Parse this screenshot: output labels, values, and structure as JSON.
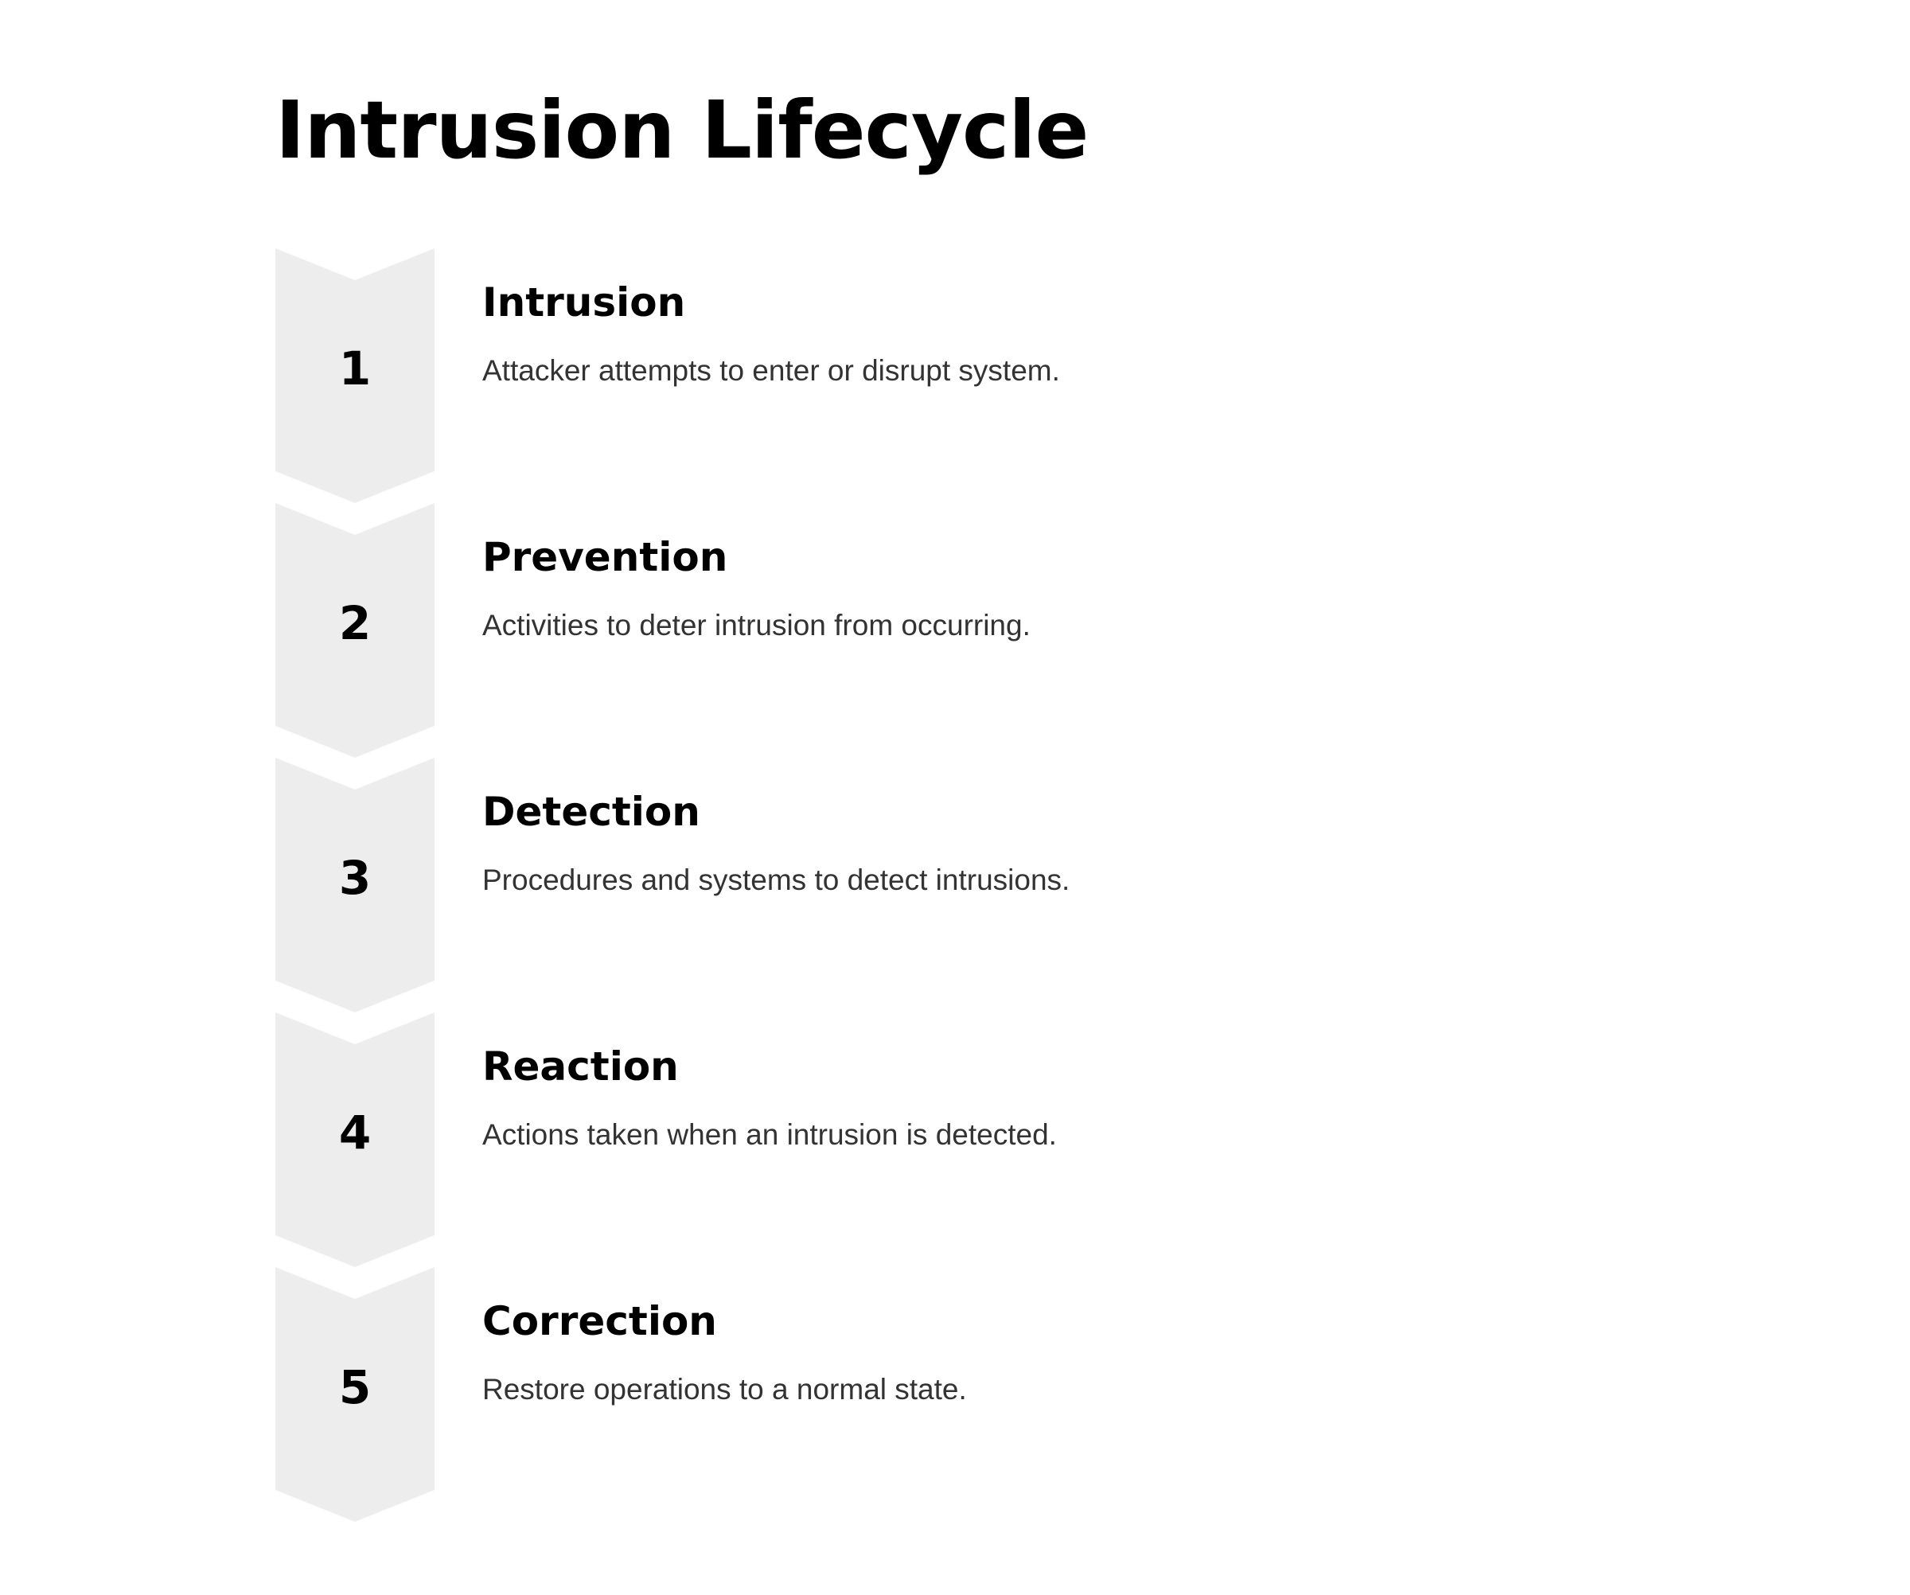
{
  "title": "Intrusion Lifecycle",
  "colors": {
    "chevron_fill": "#EDEDED",
    "title_text": "#000000",
    "description_text": "#333333",
    "background": "#FFFFFF"
  },
  "steps": [
    {
      "number": "1",
      "title": "Intrusion",
      "description": "Attacker attempts to enter or disrupt system."
    },
    {
      "number": "2",
      "title": "Prevention",
      "description": "Activities to deter intrusion from occurring."
    },
    {
      "number": "3",
      "title": "Detection",
      "description": "Procedures and systems to detect intrusions."
    },
    {
      "number": "4",
      "title": "Reaction",
      "description": "Actions taken when an intrusion is detected."
    },
    {
      "number": "5",
      "title": "Correction",
      "description": "Restore operations to a normal state."
    }
  ]
}
